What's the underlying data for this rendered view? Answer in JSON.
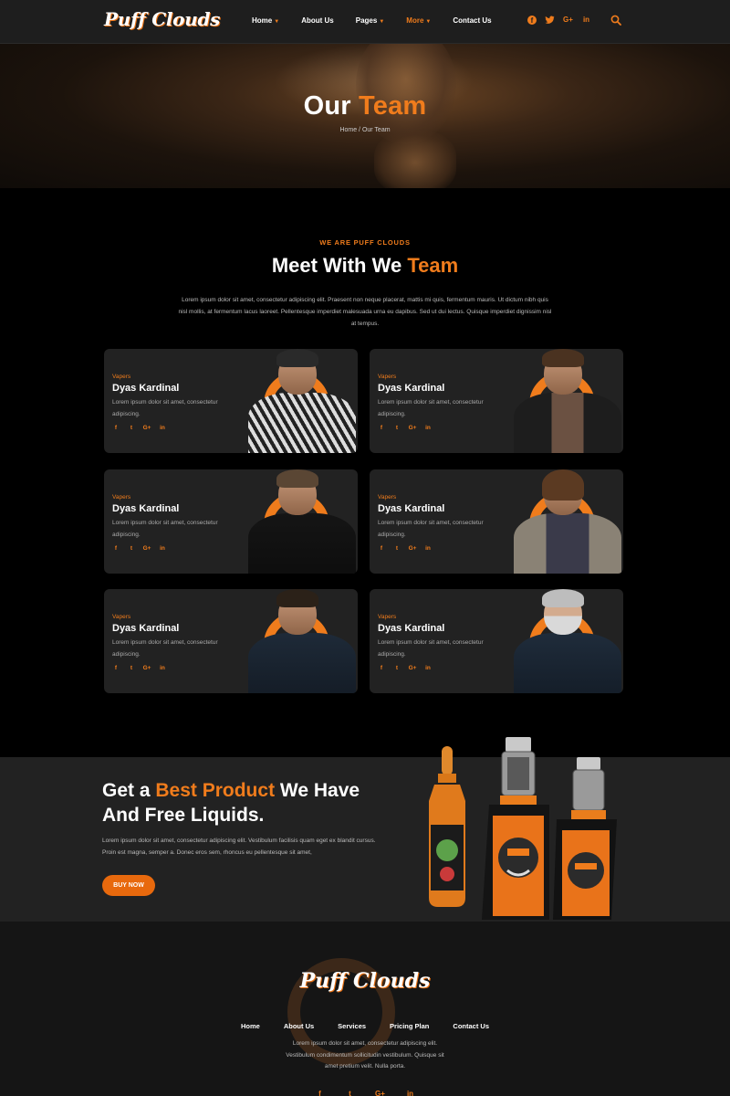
{
  "brand": {
    "logo": "Puff Clouds",
    "accent": "#f07c1c"
  },
  "nav": {
    "items": [
      {
        "label": "Home",
        "dropdown": true,
        "active": false
      },
      {
        "label": "About Us",
        "dropdown": false,
        "active": false
      },
      {
        "label": "Pages",
        "dropdown": true,
        "active": false
      },
      {
        "label": "More",
        "dropdown": true,
        "active": true
      },
      {
        "label": "Contact Us",
        "dropdown": false,
        "active": false
      }
    ],
    "social": [
      "facebook-icon",
      "twitter-icon",
      "google-plus-icon",
      "linkedin-icon"
    ],
    "search_icon": "search-icon"
  },
  "hero": {
    "title_plain": "Our",
    "title_accent": "Team",
    "breadcrumb": "Home / Our Team"
  },
  "team": {
    "eyebrow": "WE ARE PUFF CLOUDS",
    "title_plain": "Meet With We",
    "title_accent": "Team",
    "description": "Lorem ipsum dolor sit amet, consectetur adipiscing elit. Praesent non neque placerat, mattis mi quis, fermentum mauris. Ut dictum nibh quis nisl mollis, at fermentum lacus laoreet. Pellentesque imperdiet malesuada urna eu dapibus. Sed ut dui lectus. Quisque imperdiet dignissim nisl at tempus.",
    "members": [
      {
        "role": "Vapers",
        "name": "Dyas Kardinal",
        "bio": "Lorem ipsum dolor sit amet, consectetur adipiscing."
      },
      {
        "role": "Vapers",
        "name": "Dyas Kardinal",
        "bio": "Lorem ipsum dolor sit amet, consectetur adipiscing."
      },
      {
        "role": "Vapers",
        "name": "Dyas Kardinal",
        "bio": "Lorem ipsum dolor sit amet, consectetur adipiscing."
      },
      {
        "role": "Vapers",
        "name": "Dyas Kardinal",
        "bio": "Lorem ipsum dolor sit amet, consectetur adipiscing."
      },
      {
        "role": "Vapers",
        "name": "Dyas Kardinal",
        "bio": "Lorem ipsum dolor sit amet, consectetur adipiscing."
      },
      {
        "role": "Vapers",
        "name": "Dyas Kardinal",
        "bio": "Lorem ipsum dolor sit amet, consectetur adipiscing."
      }
    ]
  },
  "promo": {
    "line1_plain": "Get a",
    "line1_accent": "Best Product",
    "line1_rest": "We Have",
    "line2": "And Free Liquids.",
    "description": "Lorem ipsum dolor sit amet, consectetur adipiscing elit. Vestibulum facilisis quam eget ex blandit cursus. Proin est magna, semper a. Donec eros sem, rhoncus eu pellentesque sit amet,",
    "button": "BUY NOW"
  },
  "footer": {
    "logo": "Puff Clouds",
    "menu": [
      "Home",
      "About Us",
      "Services",
      "Pricing Plan",
      "Contact Us"
    ],
    "description": "Lorem ipsum dolor sit amet, consectetur adipiscing elit. Vestibulum condimentum sollicitudin vestibulum. Quisque sit amet pretium velit. Nulla porta."
  }
}
